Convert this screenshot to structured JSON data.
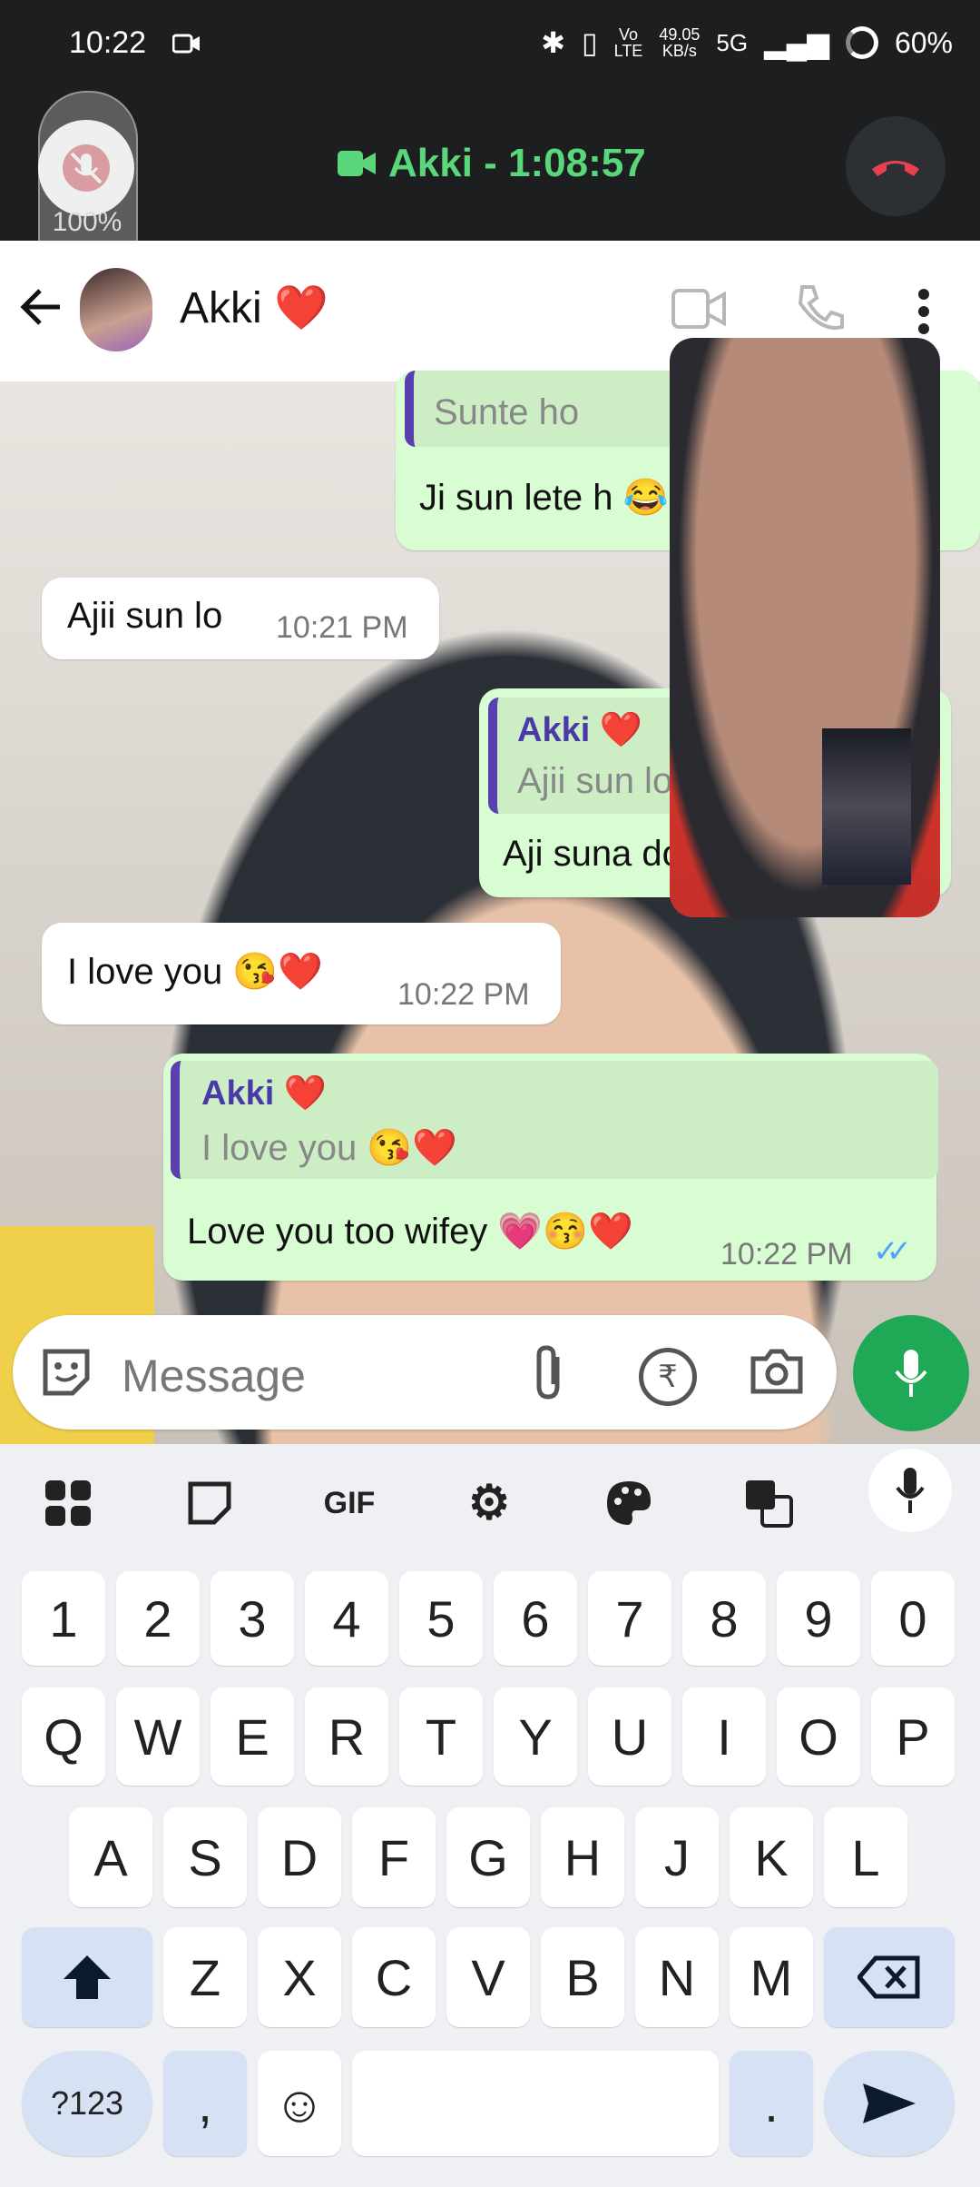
{
  "status_bar": {
    "time": "10:22",
    "net_speed_top": "49.05",
    "net_speed_bottom": "KB/s",
    "network": "5G",
    "battery": "60%"
  },
  "call_bar": {
    "title": "Akki - 1:08:57",
    "volume_percent": "100%"
  },
  "header": {
    "contact_name": "Akki ❤️"
  },
  "messages": {
    "m1": {
      "quote_text": "Sunte ho",
      "text": "Ji sun lete h 😂"
    },
    "m2": {
      "text": "Ajii sun lo",
      "time": "10:21 PM"
    },
    "m3": {
      "quote_name": "Akki ❤️",
      "quote_text": "Ajii sun lo",
      "text": "Aji suna do"
    },
    "m4": {
      "text": "I love you 😘❤️",
      "time": "10:22 PM"
    },
    "m5": {
      "quote_name": "Akki ❤️",
      "quote_text": "I love you 😘❤️",
      "text": "Love you too wifey 💗😚❤️",
      "time": "10:22 PM",
      "status": "✓✓"
    }
  },
  "composer": {
    "placeholder": "Message"
  },
  "keyboard": {
    "toolbar": [
      "apps-grid",
      "sticker",
      "GIF",
      "settings",
      "theme",
      "translate"
    ],
    "gif_label": "GIF",
    "row_numbers": [
      "1",
      "2",
      "3",
      "4",
      "5",
      "6",
      "7",
      "8",
      "9",
      "0"
    ],
    "row_q": [
      "Q",
      "W",
      "E",
      "R",
      "T",
      "Y",
      "U",
      "I",
      "O",
      "P"
    ],
    "row_a": [
      "A",
      "S",
      "D",
      "F",
      "G",
      "H",
      "J",
      "K",
      "L"
    ],
    "row_z": [
      "Z",
      "X",
      "C",
      "V",
      "B",
      "N",
      "M"
    ],
    "symbols_label": "?123",
    "comma": ",",
    "period": ".",
    "emoji": "☺"
  },
  "colors": {
    "call_green": "#59d77a",
    "end_call_red": "#e8414d",
    "outgoing_bubble": "#d8fdd2",
    "mic_button": "#1fa855",
    "quote_accent": "#5b3fb0",
    "read_ticks": "#4fa3ff"
  }
}
